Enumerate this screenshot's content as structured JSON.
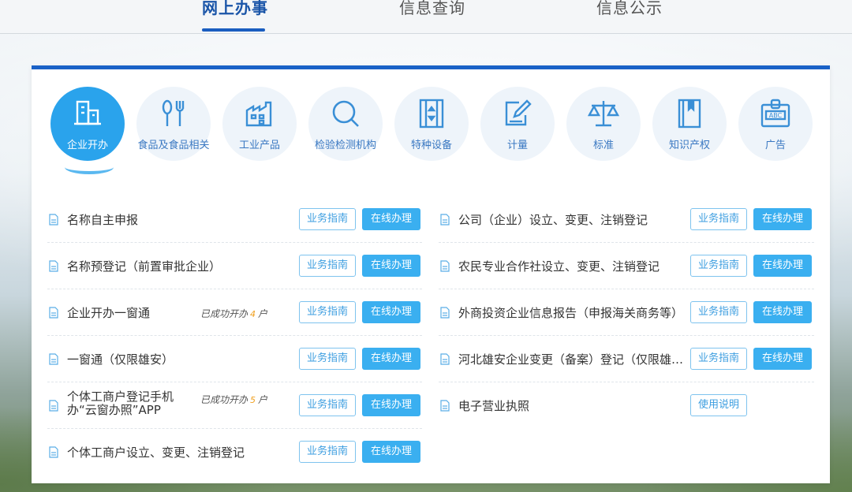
{
  "nav": {
    "tabs": [
      {
        "label": "网上办事"
      },
      {
        "label": "信息查询"
      },
      {
        "label": "信息公示"
      }
    ]
  },
  "categories": [
    {
      "label": "企业开办",
      "icon": "building-icon",
      "active": true
    },
    {
      "label": "食品及食品相关",
      "icon": "utensils-icon"
    },
    {
      "label": "工业产品",
      "icon": "factory-icon"
    },
    {
      "label": "检验检测机构",
      "icon": "magnifier-icon"
    },
    {
      "label": "特种设备",
      "icon": "elevator-icon"
    },
    {
      "label": "计量",
      "icon": "edit-icon"
    },
    {
      "label": "标准",
      "icon": "scales-icon"
    },
    {
      "label": "知识产权",
      "icon": "book-icon"
    },
    {
      "label": "广告",
      "icon": "abc-badge-icon"
    }
  ],
  "buttons": {
    "guide": "业务指南",
    "online": "在线办理",
    "manual": "使用说明"
  },
  "left_items": [
    {
      "title": "名称自主申报"
    },
    {
      "title": "名称预登记（前置审批企业）"
    },
    {
      "title": "企业开办一窗通",
      "done_prefix": "已成功开办",
      "done_count": "4",
      "done_suffix": "户"
    },
    {
      "title": "一窗通（仅限雄安）"
    },
    {
      "title": "个体工商户登记手机办“云窗办照”APP",
      "done_prefix": "已成功开办",
      "done_count": "5",
      "done_suffix": "户"
    },
    {
      "title": "个体工商户设立、变更、注销登记"
    }
  ],
  "right_items": [
    {
      "title": "公司（企业）设立、变更、注销登记"
    },
    {
      "title": "农民专业合作社设立、变更、注销登记"
    },
    {
      "title": "外商投资企业信息报告（申报海关商务等）"
    },
    {
      "title": "河北雄安企业变更（备案）登记（仅限雄安）"
    },
    {
      "title": "电子营业执照"
    }
  ],
  "colors": {
    "brand_blue": "#1a62c7",
    "button_blue": "#3aaff0",
    "active_circle": "#2aa3ec",
    "done_count": "#f0a020"
  }
}
